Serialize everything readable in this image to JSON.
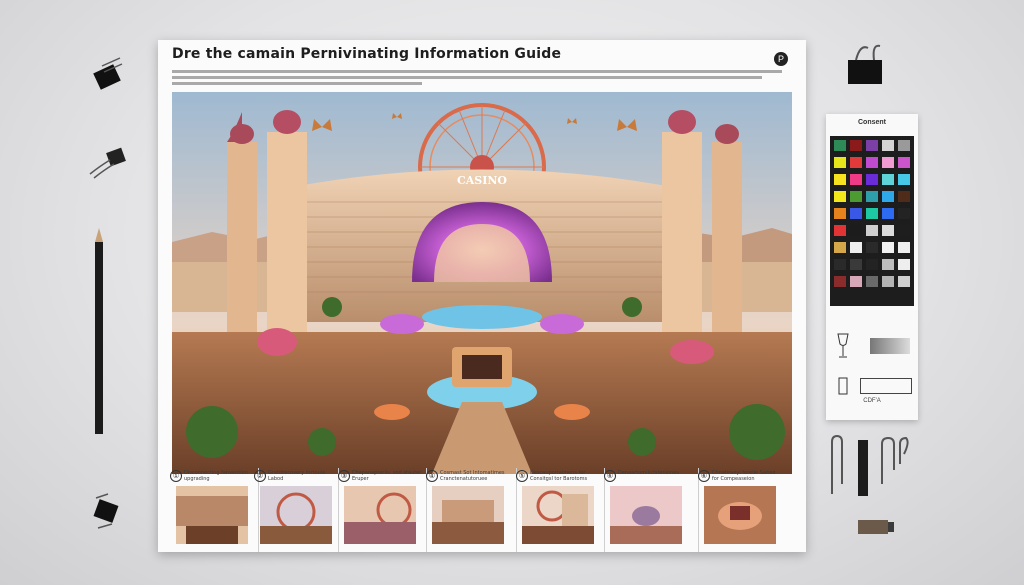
{
  "poster": {
    "title": "Dre the camain Pernivinating Information Guide"
  },
  "steps": [
    {
      "num": "①",
      "caption": "Disconnecting fanvention upgrading"
    },
    {
      "num": "②",
      "caption": "Gratitrecovery fortouie Labod"
    },
    {
      "num": "③",
      "caption": "Chapanapterlis. sod stauter Eruper"
    },
    {
      "num": "④",
      "caption": "Cosmast Sot Intomatimes Cranctenatutoruee"
    },
    {
      "num": "⑤",
      "caption": "Descauportalmens fer Consitgsl tor Barotoms"
    },
    {
      "num": "⑥",
      "caption": "Deneartomilicfsteniones"
    },
    {
      "num": "⑥",
      "caption": "Chnatiraeyl fereile Saitee for Compeaseion"
    }
  ],
  "swatch_card": {
    "title": "Consent",
    "footer": "CDF'A",
    "colors": [
      "#2e8b57",
      "#8b1a1a",
      "#7b3fa6",
      "#d4d4d4",
      "#9a9a9a",
      "#e6e61a",
      "#e03a3a",
      "#c04ad0",
      "#f29ad2",
      "#cc55cc",
      "#f7e31e",
      "#ef3b86",
      "#6a2bd9",
      "#5fd4d8",
      "#46c9e6",
      "#f3e81a",
      "#4c9a32",
      "#2e9eaa",
      "#2ea8e8",
      "#4f2b1a",
      "#e6831d",
      "#3a58e6",
      "#1ec8a2",
      "#2d6bf0",
      "#232323",
      "#e23434",
      "#1c1c1c",
      "#cfcfcf",
      "#dcdcdc",
      "#1e1e1e",
      "#d4a84a",
      "#efefef",
      "#2a2a2a",
      "#f2f2f2",
      "#efefef",
      "#2a2a2a",
      "#3a3a3a",
      "#232323",
      "#bdbdbd",
      "#eeeeee",
      "#8a2c2c",
      "#d8a8b8",
      "#6a6a6a",
      "#b3b3b3",
      "#d0d0d0"
    ]
  },
  "accent": {
    "sky": "#b8cfe0",
    "desert": "#d9b08c",
    "facade": "#e8c4a2",
    "neon": "#c86bd8"
  }
}
